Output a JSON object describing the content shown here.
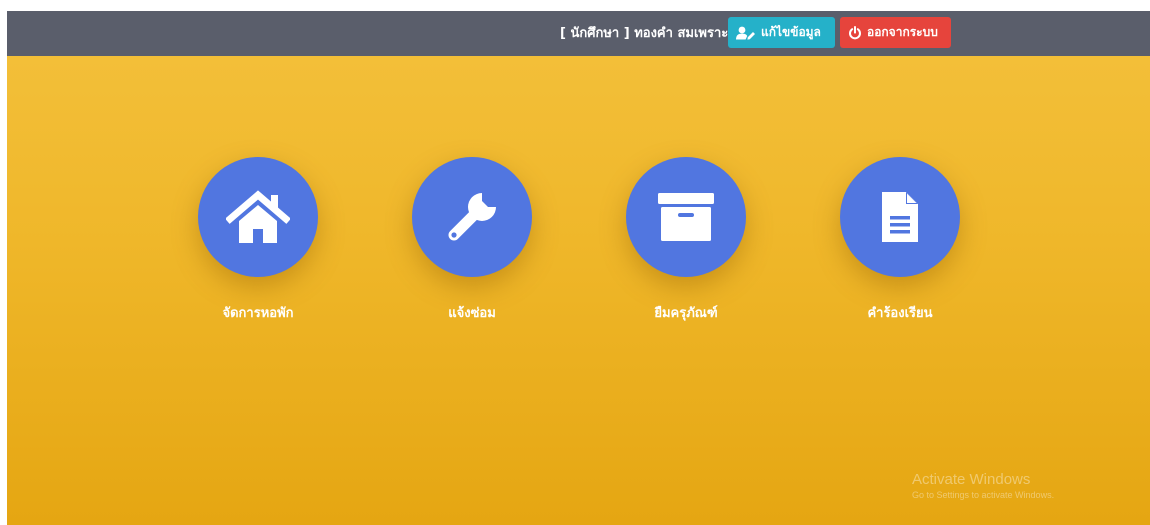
{
  "header": {
    "user_label": "[ นักศึกษา ] ทองคำ สมเพราะ",
    "edit_button": "แก้ไขข้อมูล",
    "logout_button": "ออกจากระบบ"
  },
  "menu": [
    {
      "label": "จัดการหอพัก",
      "icon": "home-icon"
    },
    {
      "label": "แจ้งซ่อม",
      "icon": "wrench-icon"
    },
    {
      "label": "ยืมครุภัณฑ์",
      "icon": "archive-icon"
    },
    {
      "label": "คำร้องเรียน",
      "icon": "document-icon"
    }
  ],
  "watermark": {
    "title": "Activate Windows",
    "subtitle": "Go to Settings to activate Windows."
  },
  "colors": {
    "topbar": "#5a5e6b",
    "background_top": "#f4c13c",
    "background_bottom": "#e5a612",
    "circle": "#5176e0",
    "edit_button": "#25b1c9",
    "logout_button": "#e6443c"
  }
}
